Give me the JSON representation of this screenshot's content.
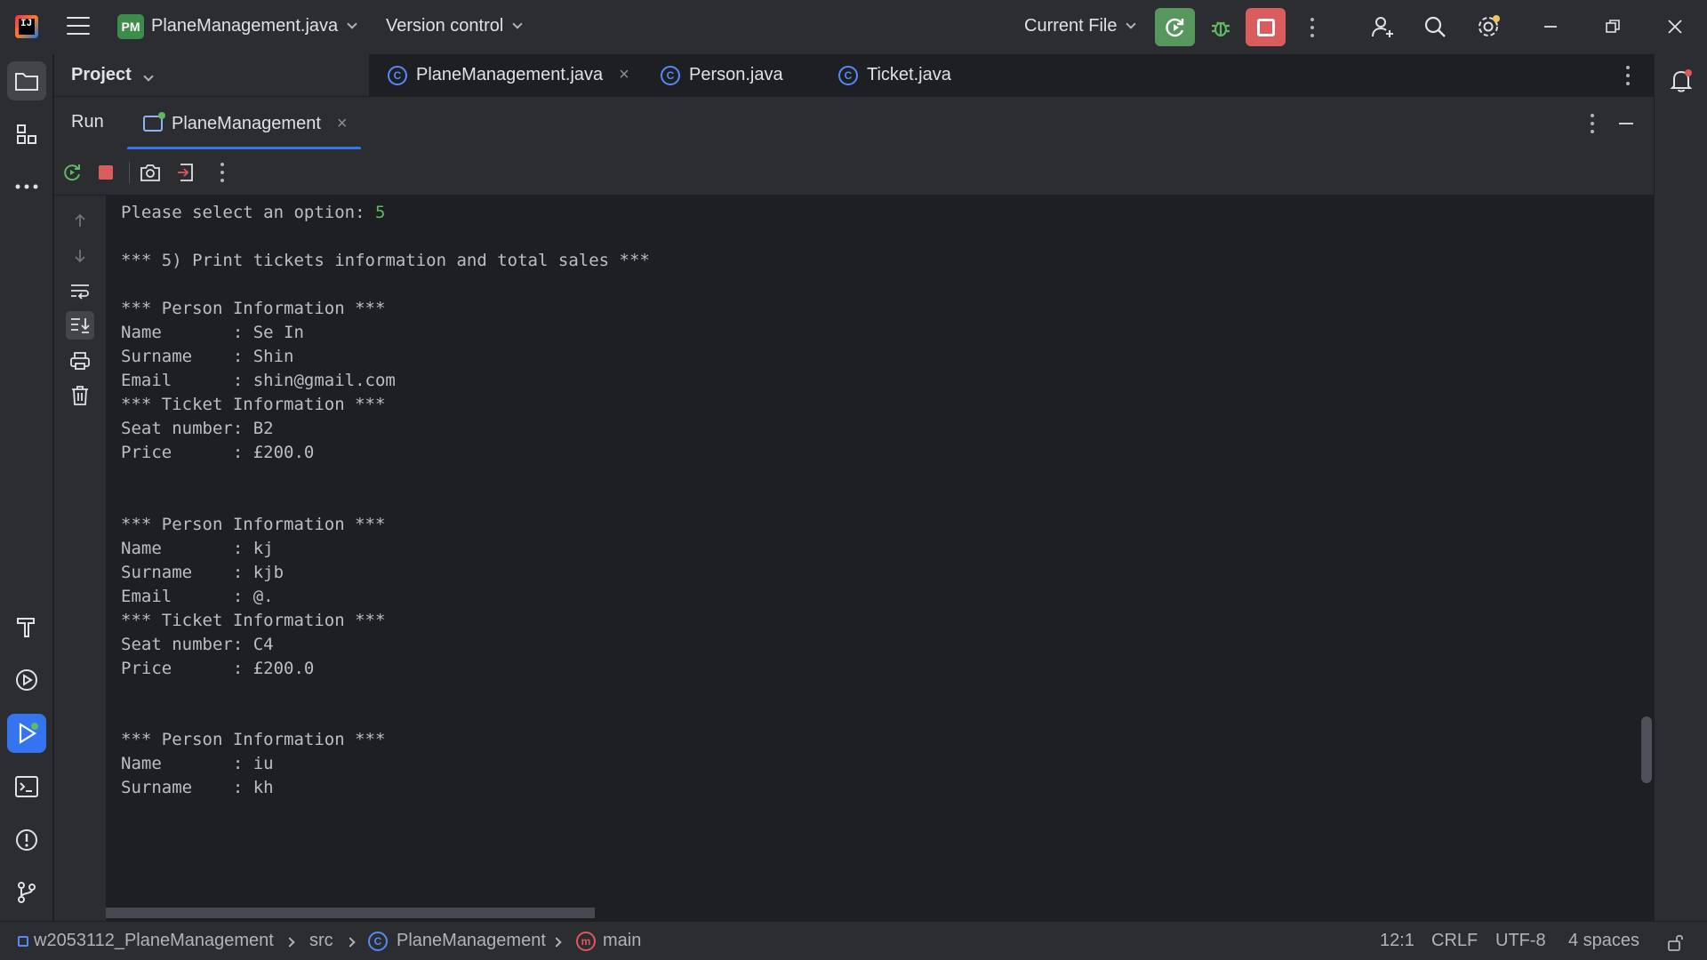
{
  "titlebar": {
    "project_badge": "PM",
    "project_name": "PlaneManagement.java",
    "version_control": "Version control",
    "run_config": "Current File"
  },
  "project_panel": {
    "title": "Project"
  },
  "editor_tabs": [
    {
      "label": "PlaneManagement.java",
      "active": true
    },
    {
      "label": "Person.java"
    },
    {
      "label": "Ticket.java"
    }
  ],
  "run_window": {
    "title": "Run",
    "tab_label": "PlaneManagement"
  },
  "console": {
    "lines": [
      {
        "text": "Please select an option: ",
        "input": "5"
      },
      {
        "text": "*** 5) Print tickets information and total sales ***"
      },
      {
        "text": "*** Person Information ***"
      },
      {
        "text": "Name       : Se In"
      },
      {
        "text": "Surname    : Shin"
      },
      {
        "text": "Email      : shin@gmail.com"
      },
      {
        "text": "*** Ticket Information ***"
      },
      {
        "text": "Seat number: B2"
      },
      {
        "text": "Price      : £200.0"
      },
      {
        "text": "*** Person Information ***"
      },
      {
        "text": "Name       : kj"
      },
      {
        "text": "Surname    : kjb"
      },
      {
        "text": "Email      : @."
      },
      {
        "text": "*** Ticket Information ***"
      },
      {
        "text": "Seat number: C4"
      },
      {
        "text": "Price      : £200.0"
      },
      {
        "text": "*** Person Information ***"
      },
      {
        "text": "Name       : iu"
      },
      {
        "text": "Surname    : kh"
      }
    ]
  },
  "statusbar": {
    "module": "w2053112_PlaneManagement",
    "src": "src",
    "class": "PlaneManagement",
    "method": "main",
    "position": "12:1",
    "line_sep": "CRLF",
    "encoding": "UTF-8",
    "indent": "4 spaces"
  },
  "colors": {
    "accent": "#3574f0",
    "run_green": "#57965c",
    "stop_red": "#db5c5c",
    "input_green": "#5fb865"
  }
}
